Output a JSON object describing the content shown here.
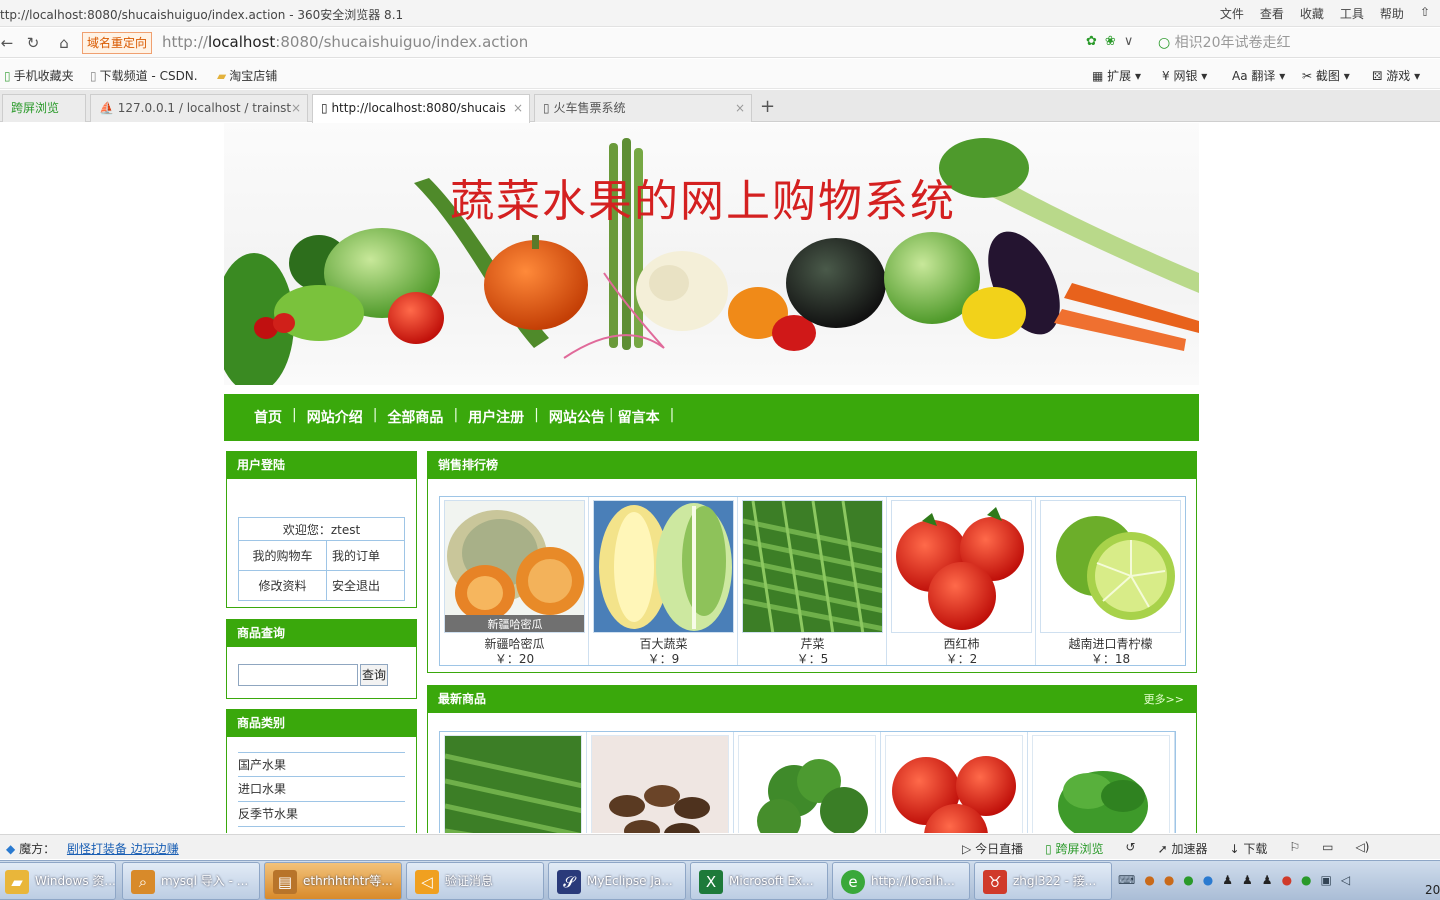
{
  "browser": {
    "window_title": "ttp://localhost:8080/shucaishuiguo/index.action - 360安全浏览器 8.1",
    "menus": [
      "文件",
      "查看",
      "收藏",
      "工具",
      "帮助"
    ],
    "redirect_label": "域名重定向",
    "url_prefix": "http://",
    "url_host": "localhost",
    "url_rest": ":8080/shucaishuiguo/index.action",
    "search_text": "相识20年试卷走红",
    "bookmarks": [
      "手机收藏夹",
      "下载频道 - CSDN.",
      "淘宝店铺"
    ],
    "extensions": [
      "扩展",
      "网银",
      "翻译",
      "截图",
      "游戏"
    ],
    "tabs": [
      "跨屏浏览",
      "127.0.0.1 / localhost / trainst",
      "http://localhost:8080/shucais",
      "火车售票系统"
    ]
  },
  "site": {
    "banner_title": "蔬菜水果的网上购物系统",
    "nav": [
      "首页",
      "网站介绍",
      "全部商品",
      "用户注册",
      "网站公告",
      "留言本"
    ]
  },
  "login": {
    "title": "用户登陆",
    "welcome": "欢迎您：ztest",
    "cart": "我的购物车",
    "orders": "我的订单",
    "profile": "修改资料",
    "logout": "安全退出"
  },
  "query": {
    "title": "商品查询",
    "button": "查询"
  },
  "categories": {
    "title": "商品类别",
    "items": [
      "国产水果",
      "进口水果",
      "反季节水果"
    ]
  },
  "ranking": {
    "title": "销售排行榜",
    "products": [
      {
        "name": "新疆哈密瓜",
        "price": "￥：20",
        "caption": "新疆哈密瓜"
      },
      {
        "name": "百大蔬菜",
        "price": "￥：9"
      },
      {
        "name": "芹菜",
        "price": "￥：5"
      },
      {
        "name": "西红柿",
        "price": "￥：2"
      },
      {
        "name": "越南进口青柠檬",
        "price": "￥：18"
      }
    ]
  },
  "newest": {
    "title": "最新商品",
    "more": "更多>>"
  },
  "statusbar": {
    "prefix": "魔方：",
    "link": "剧怪打装备 边玩边赚",
    "items": [
      "今日直播",
      "跨屏浏览",
      "加速器",
      "下载"
    ]
  },
  "taskbar": {
    "items": [
      "Windows 资...",
      "mysql 导入 - ...",
      "ethrhhtrhtr等...",
      "验证消息",
      "MyEclipse Ja...",
      "Microsoft Ex...",
      "http://localh...",
      "zhgl322 - 接..."
    ],
    "clock": "20"
  }
}
